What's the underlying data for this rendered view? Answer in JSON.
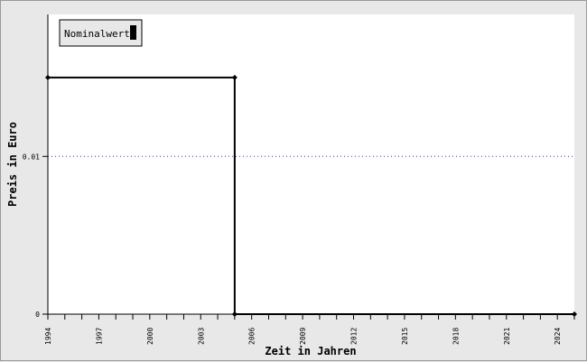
{
  "chart_data": {
    "type": "line",
    "title": "",
    "xlabel": "Zeit in Jahren",
    "ylabel": "Preis in Euro",
    "xlim": [
      1994,
      2025
    ],
    "ylim": [
      0,
      0.019
    ],
    "x_ticks_labeled": [
      "1994",
      "1997",
      "2000",
      "2003",
      "2006",
      "2009",
      "2012",
      "2015",
      "2018",
      "2021",
      "2024"
    ],
    "y_ticks": [
      {
        "value": 0,
        "label": "0"
      },
      {
        "value": 0.01,
        "label": "0.01"
      }
    ],
    "reference_line": {
      "value": 0.01,
      "style": "dotted",
      "color": "#3a3aa0"
    },
    "grid": false,
    "legend": {
      "placement": "top-left"
    },
    "series": [
      {
        "name": "Nominalwert",
        "color": "#000000",
        "step": true,
        "points": [
          {
            "x": 1994,
            "y": 0.015
          },
          {
            "x": 2005,
            "y": 0.015
          },
          {
            "x": 2005,
            "y": 0
          },
          {
            "x": 2025,
            "y": 0
          }
        ]
      }
    ]
  }
}
